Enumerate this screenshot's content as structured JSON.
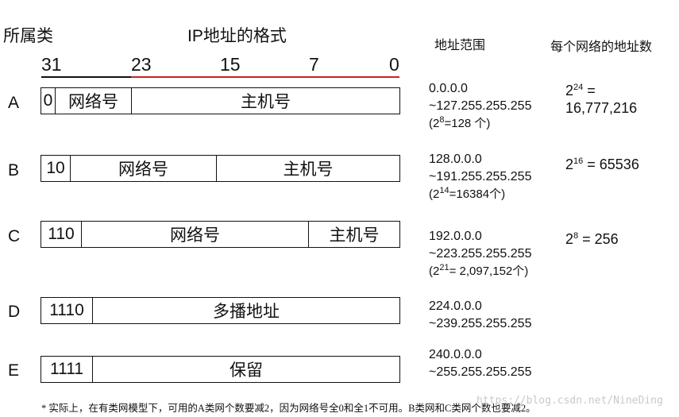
{
  "headers": {
    "class": "所属类",
    "format": "IP地址的格式",
    "range": "地址范围",
    "count": "每个网络的地址数"
  },
  "bits": [
    "31",
    "23",
    "15",
    "7",
    "0"
  ],
  "rows": [
    {
      "label": "A",
      "prefix": "0",
      "network": "网络号",
      "host": "主机号",
      "range_start": "0.0.0.0",
      "range_end": "~127.255.255.255",
      "note_base": "(2",
      "note_exp": "8",
      "note_rest": "=128 个)",
      "count_base": "2",
      "count_exp": "24",
      "count_rest": " =",
      "count_line2": "16,777,216"
    },
    {
      "label": "B",
      "prefix": "10",
      "network": "网络号",
      "host": "主机号",
      "range_start": "128.0.0.0",
      "range_end": "~191.255.255.255",
      "note_base": "(2",
      "note_exp": "14",
      "note_rest": "=16384个)",
      "count_base": "2",
      "count_exp": "16",
      "count_rest": " = 65536"
    },
    {
      "label": "C",
      "prefix": "110",
      "network": "网络号",
      "host": "主机号",
      "range_start": "192.0.0.0",
      "range_end": "~223.255.255.255",
      "note_base": "(2",
      "note_exp": "21",
      "note_rest": "= 2,097,152个)",
      "count_base": "2",
      "count_exp": "8",
      "count_rest": " = 256"
    },
    {
      "label": "D",
      "prefix": "1110",
      "body": "多播地址",
      "range_start": "224.0.0.0",
      "range_end": "~239.255.255.255"
    },
    {
      "label": "E",
      "prefix": "1111",
      "body": "保留",
      "range_start": "240.0.0.0",
      "range_end": "~255.255.255.255"
    }
  ],
  "footnote": "* 实际上，在有类网模型下，可用的A类网个数要减2，因为网络号全0和全1不可用。B类网和C类网个数也要减2。",
  "watermark": "https://blog.csdn.net/NineDing",
  "colors": {
    "bit_line_black": "#111111",
    "bit_line_red": "#cc2222"
  }
}
